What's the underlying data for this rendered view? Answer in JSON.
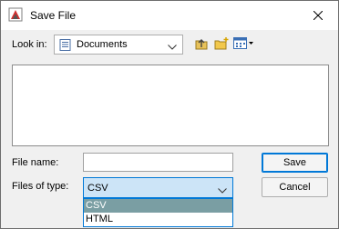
{
  "window": {
    "title": "Save File"
  },
  "lookin": {
    "label": "Look in:",
    "value": "Documents"
  },
  "toolbar": {
    "up_icon": "up-one-level-icon",
    "new_folder_icon": "new-folder-icon",
    "view_icon": "view-menu-icon"
  },
  "filename": {
    "label": "File name:",
    "value": ""
  },
  "filetype": {
    "label": "Files of type:",
    "value": "CSV",
    "options": [
      "CSV",
      "HTML"
    ]
  },
  "buttons": {
    "save": "Save",
    "cancel": "Cancel"
  },
  "colors": {
    "accent": "#0078d7",
    "selected_option": "#7a9ea3",
    "combo_focus": "#cce4f7"
  }
}
